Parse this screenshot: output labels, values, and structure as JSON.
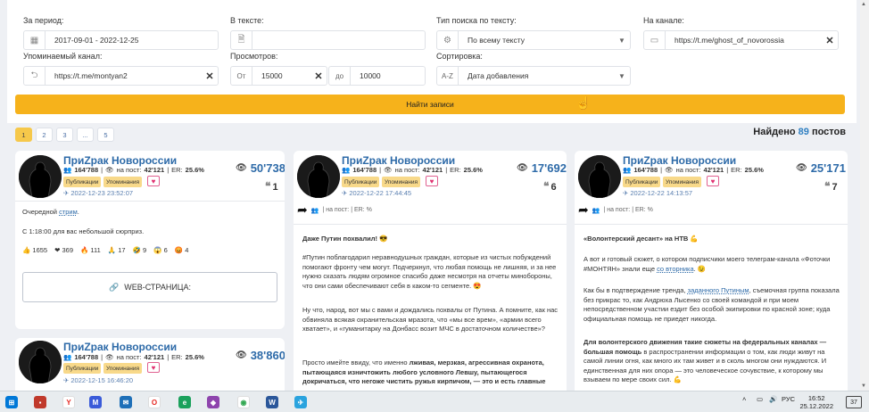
{
  "filters": {
    "period": {
      "label": "За период:",
      "value": "2017-09-01 - 2022-12-25"
    },
    "text": {
      "label": "В тексте:",
      "value": ""
    },
    "search_type": {
      "label": "Тип поиска по тексту:",
      "value": "По всему тексту"
    },
    "channel": {
      "label": "На канале:",
      "value": "https://t.me/ghost_of_novorossia"
    },
    "mentioned": {
      "label": "Упоминаемый канал:",
      "value": "https://t.me/montyan2"
    },
    "views": {
      "label": "Просмотров:",
      "from_prefix": "От",
      "from": "15000",
      "to_prefix": "до",
      "to": "10000"
    },
    "sort": {
      "label": "Сортировка:",
      "value": "Дата добавления",
      "prefix": "A-Z"
    },
    "search_button": "Найти записи"
  },
  "pagination": {
    "pages": [
      "1",
      "2",
      "3",
      "...",
      "5"
    ],
    "active": "1"
  },
  "found": {
    "prefix": "Найдено",
    "count": "89",
    "suffix": "постов"
  },
  "cards": [
    {
      "channel": "ПриZрак Новороссии",
      "subscribers": "164'788",
      "per_post_label": "на пост:",
      "per_post": "42'121",
      "er_label": "ER:",
      "er": "25.6%",
      "tag1": "Публикации",
      "tag2": "Упоминания",
      "date": "2022-12-23 23:52:07",
      "views": "50'738",
      "quotes": "1",
      "text1_pre": "Очередной ",
      "text1_link": "стрим",
      "text1_post": ".",
      "text2": "С 1:18:00 для вас небольшой сюрприз.",
      "reactions": [
        "👍 1655",
        "❤ 369",
        "🔥 111",
        "🙏 17",
        "🤣 9",
        "😱 6",
        "😡 4"
      ],
      "web_button": "WEB-СТРАНИЦА:"
    },
    {
      "channel": "ПриZрак Новороссии",
      "subscribers": "164'788",
      "per_post_label": "на пост:",
      "per_post": "42'121",
      "er_label": "ER:",
      "er": "25.6%",
      "tag1": "Публикации",
      "tag2": "Упоминания",
      "date": "2022-12-22 17:44:45",
      "views": "17'692",
      "quotes": "6",
      "repost_info": "| на пост: | ER: %",
      "title": "Даже Путин похвалил! 😎",
      "p1": "#Путин поблагодарил неравнодушных граждан, которые из чистых побуждений помогают фронту чем могут. Подчеркнул, что любая помощь не лишняя, и за нее нужно сказать людям огромное спасибо даже несмотря на отчеты минобороны, что они сами обеспечивают себя в каком-то сегменте. 😍",
      "p2": "Ну что, народ, вот мы с вами и дождались похвалы от Путина. А помните, как нас обвиняла всякая охранительская мразота, что «мы все врем», «армии всего хватает», и «гуманитарку на Донбасс возит МЧС в достаточном количестве»?",
      "p3_pre": "Просто имейте ввиду, что именно ",
      "p3_bold": "лживая, мерзкая, агрессивная охранота, пытающаяся изничтожить любого условного Левшу, пытающегося докричаться, что негоже чистить ружья кирпичом, — это и есть главные"
    },
    {
      "channel": "ПриZрак Новороссии",
      "subscribers": "164'788",
      "per_post_label": "на пост:",
      "per_post": "42'121",
      "er_label": "ER:",
      "er": "25.6%",
      "tag1": "Публикации",
      "tag2": "Упоминания",
      "date": "2022-12-22 14:13:57",
      "views": "25'171",
      "quotes": "7",
      "repost_info": "| на пост: | ER: %",
      "title": "«Волонтерский десант» на НТВ 💪",
      "p1_pre": "А вот и готовый сюжет, о котором подписчики моего телеграм-канала «Фоточки #МОНТЯН» знали еще ",
      "p1_link": "со вторника",
      "p1_post": ". 😉",
      "p2_pre": "Как бы в подтверждение тренда, ",
      "p2_link": "заданного Путиным",
      "p2_post": ", съемочная группа показала без прикрас то, как Андрюха Лысенко со своей командой и при моем непосредственном участии ездит без особой экипировки по красной зоне; куда официальная помощь не приедет никогда.",
      "p3_bold": "Для волонтерского движения такие сюжеты на федеральных каналах — большая помощь",
      "p3_post": " в распространении информации о том, как люди живут на самой линии огня, как много их там живет и в сколь многом они нуждаются. И единственная для них опора — это человеческое сочувствие, к которому мы взываем по мере своих сил. 💪"
    },
    {
      "channel": "ПриZрак Новороссии",
      "subscribers": "164'788",
      "per_post_label": "на пост:",
      "per_post": "42'121",
      "er_label": "ER:",
      "er": "25.6%",
      "tag1": "Публикации",
      "tag2": "Упоминания",
      "date": "2022-12-15 16:46:20",
      "views": "38'860"
    }
  ],
  "taskbar": {
    "lang": "РУС",
    "time": "16:52",
    "date": "25.12.2022",
    "notifications": "37"
  }
}
